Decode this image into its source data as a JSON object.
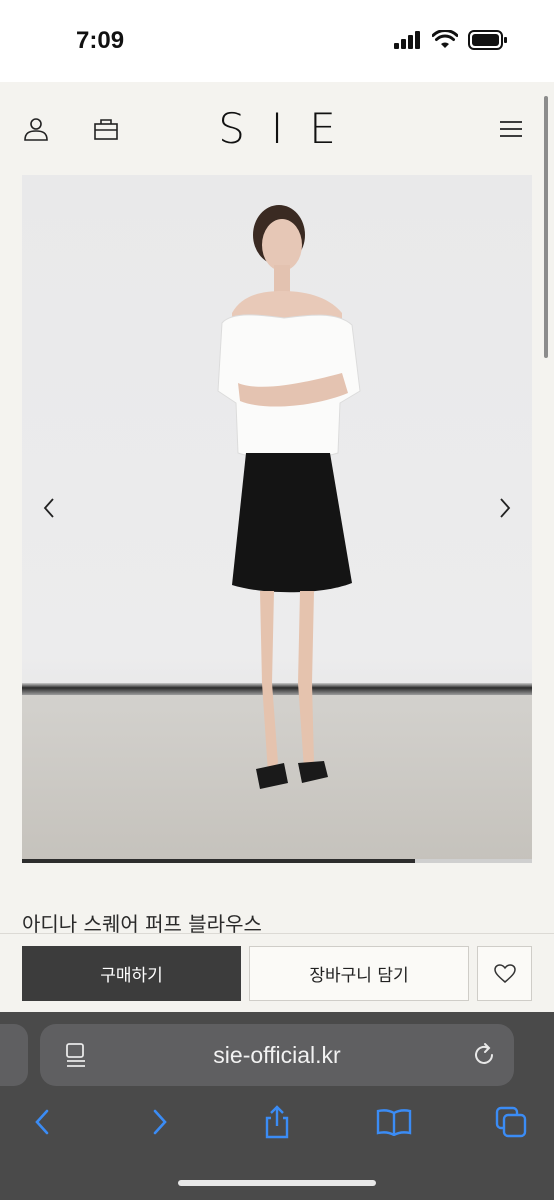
{
  "status_bar": {
    "time": "7:09",
    "icons": [
      "signal-icon",
      "wifi-icon",
      "battery-icon"
    ]
  },
  "header": {
    "logo": "SIE",
    "icons": [
      "user-icon",
      "bag-icon",
      "menu-icon"
    ]
  },
  "carousel": {
    "image_subject": "product-photo",
    "prev_icon": "chevron-left-icon",
    "next_icon": "chevron-right-icon",
    "progress": 0.77
  },
  "product": {
    "title": "아디나 스퀘어 퍼프 블라우스"
  },
  "actions": {
    "buy_label": "구매하기",
    "cart_label": "장바구니 담기",
    "wishlist_icon": "heart-icon"
  },
  "browser": {
    "url": "sie-official.kr",
    "reader_icon": "reader-icon",
    "reload_icon": "reload-icon",
    "toolbar": [
      "back-icon",
      "forward-icon",
      "share-icon",
      "bookmarks-icon",
      "tabs-icon"
    ],
    "accent_color": "#3b8cf5"
  }
}
